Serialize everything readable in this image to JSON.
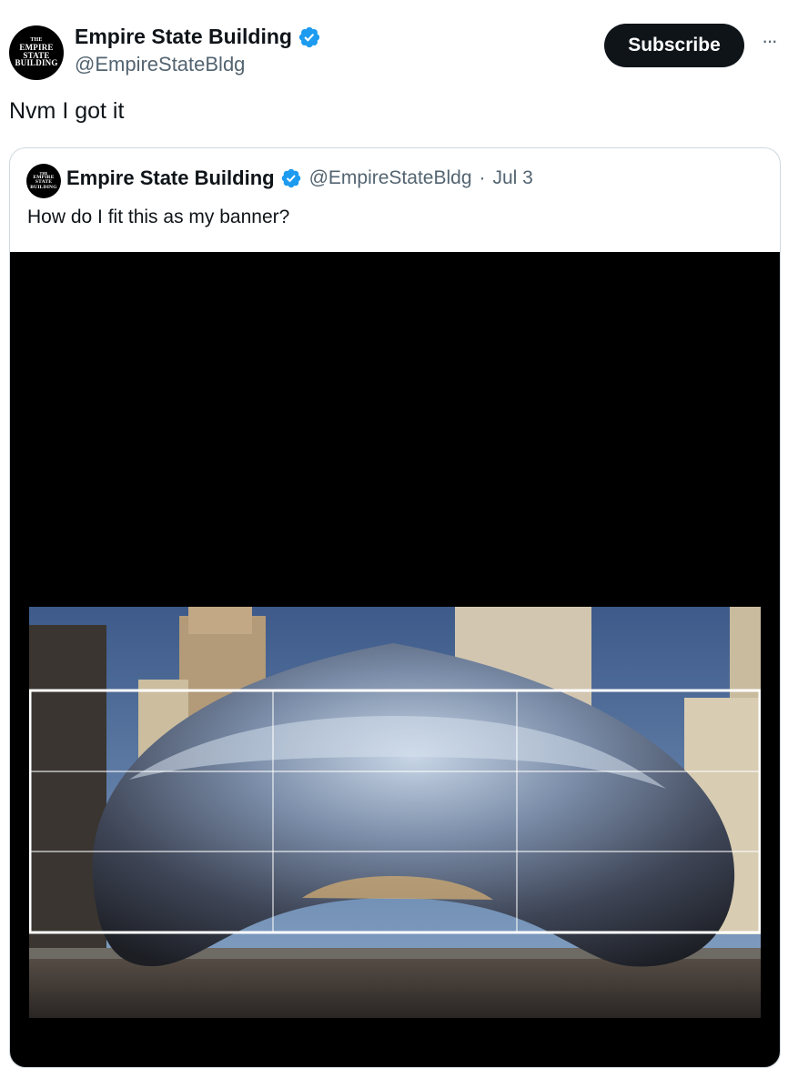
{
  "tweet": {
    "author": {
      "name": "Empire State Building",
      "handle": "@EmpireStateBldg",
      "avatar_text": [
        "THE",
        "EMPIRE",
        "STATE",
        "BUILDING"
      ],
      "verified_icon": "verified-badge-icon",
      "verified_color": "#1d9bf0"
    },
    "subscribe_label": "Subscribe",
    "more_icon": "more-horizontal-icon",
    "more_label": "···",
    "text": "Nvm I got it"
  },
  "quoted_tweet": {
    "author": {
      "name": "Empire State Building",
      "handle": "@EmpireStateBldg",
      "avatar_text": [
        "THE",
        "EMPIRE",
        "STATE",
        "BUILDING"
      ]
    },
    "separator": "·",
    "date": "Jul 3",
    "text": "How do I fit this as my banner?",
    "media": {
      "subject": "cloud-gate-photo",
      "overlay": "crop-frame-3x3-grid"
    }
  }
}
